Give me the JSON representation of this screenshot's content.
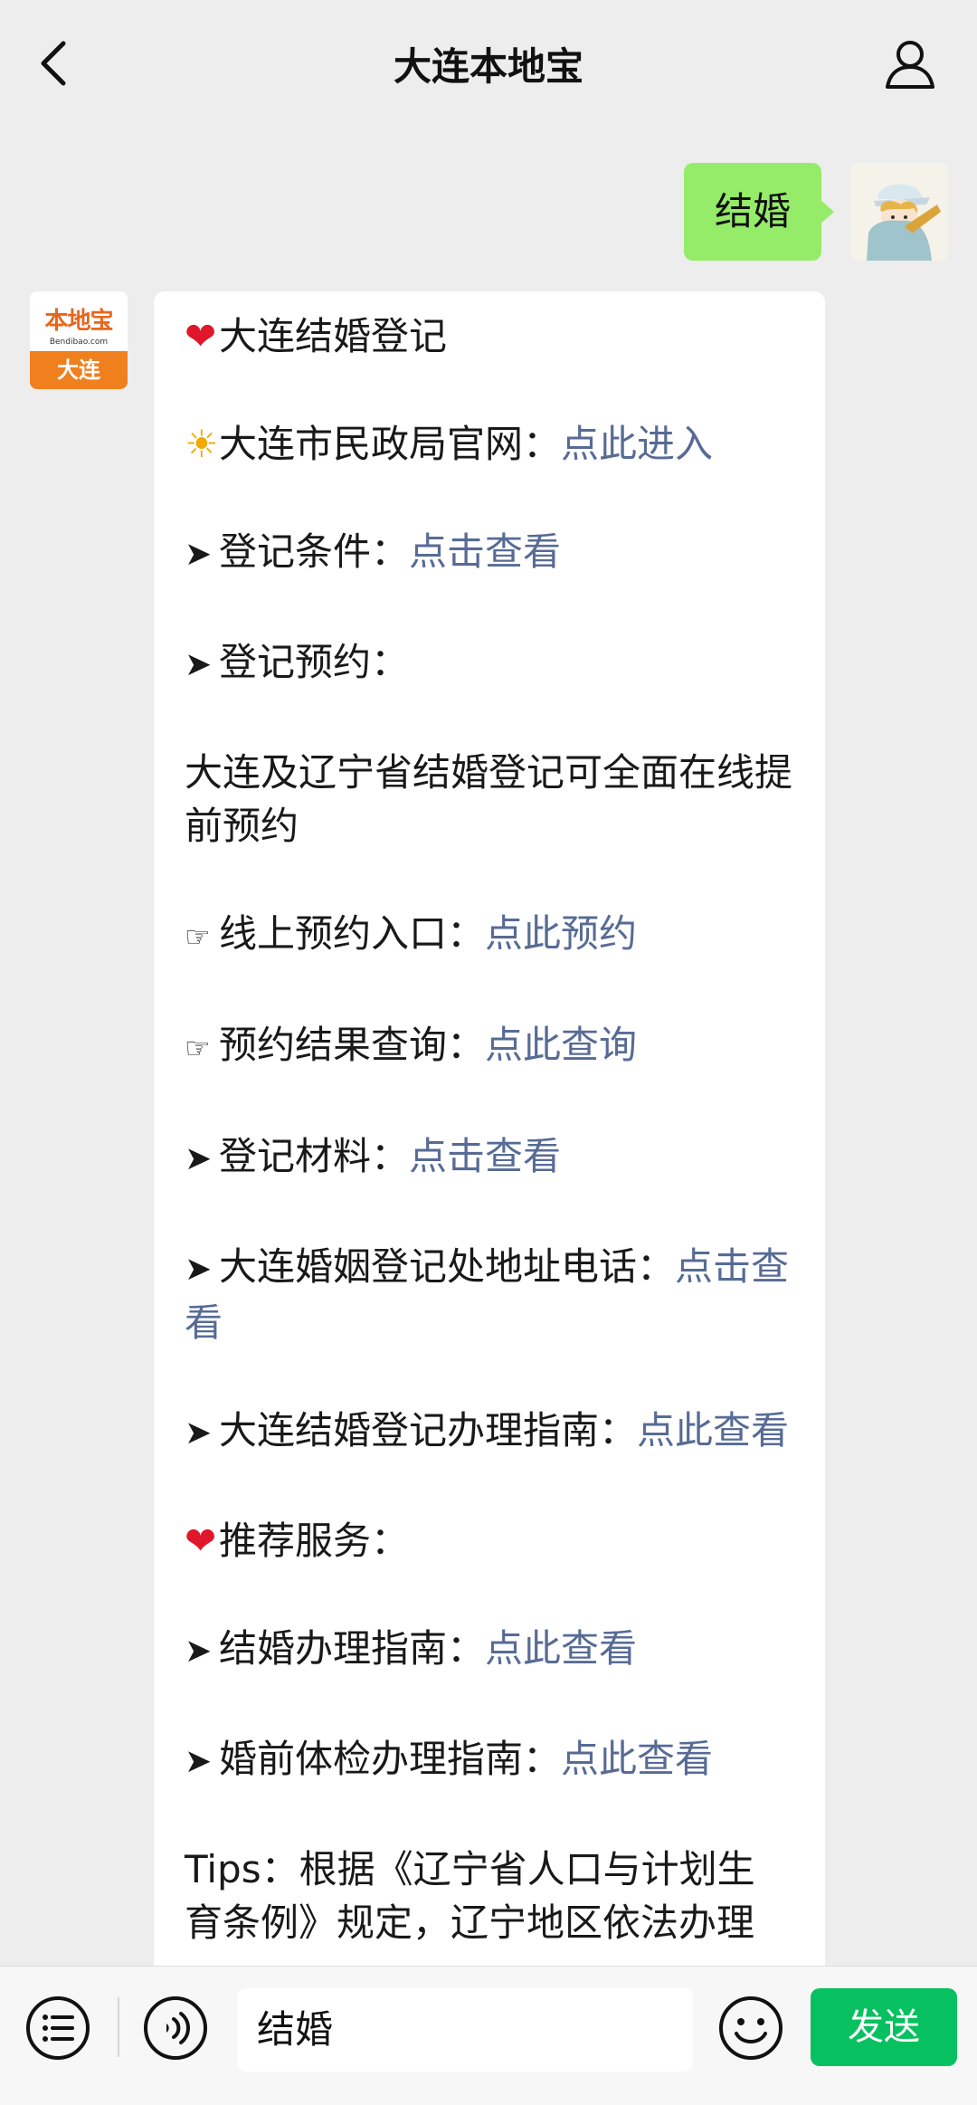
{
  "header": {
    "title": "大连本地宝"
  },
  "outgoing": {
    "text": "结婚"
  },
  "incoming_avatar": {
    "name": "本地宝",
    "url": "Bendibao.com",
    "city": "大连"
  },
  "message": {
    "title": "大连结婚登记",
    "civil_affairs": {
      "label": "大连市民政局官网：",
      "link": "点此进入"
    },
    "conditions": {
      "label": "登记条件：",
      "link": "点击查看"
    },
    "appointment": {
      "label": "登记预约："
    },
    "appointment_note": "大连及辽宁省结婚登记可全面在线提前预约",
    "online_entry": {
      "label": "线上预约入口：",
      "link": "点此预约"
    },
    "result_query": {
      "label": "预约结果查询：",
      "link": "点此查询"
    },
    "materials": {
      "label": "登记材料：",
      "link": "点击查看"
    },
    "office_contact": {
      "label": "大连婚姻登记处地址电话：",
      "link": "点击查看"
    },
    "guide": {
      "label": "大连结婚登记办理指南：",
      "link": "点此查看"
    },
    "recommended": "推荐服务：",
    "marriage_guide": {
      "label": "结婚办理指南：",
      "link": "点此查看"
    },
    "premarital_check": {
      "label": "婚前体检办理指南：",
      "link": "点此查看"
    },
    "tips": "Tips：根据《辽宁省人口与计划生育条例》规定，辽宁地区依法办理"
  },
  "input": {
    "value": "结婚",
    "send_label": "发送"
  },
  "colors": {
    "link": "#576b95",
    "bubble_out": "#95ec69",
    "send": "#07c160"
  }
}
